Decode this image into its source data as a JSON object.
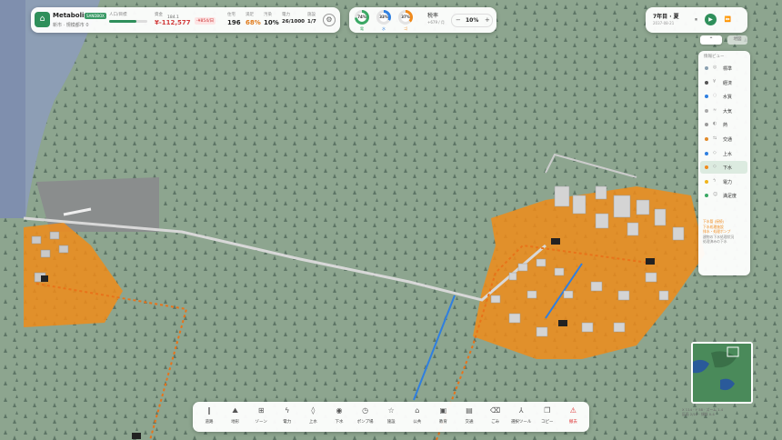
{
  "city": {
    "name": "Metabolis",
    "badge": "SANDBOX",
    "subtitle": "新市 · 規模都市 0",
    "population_label": "人口/目標",
    "population_value": "184.1",
    "population_progress": 0.72,
    "money_label": "資金",
    "money": "¥-112,577",
    "money_delta": "-¥854/日",
    "stats": [
      {
        "label": "住宅",
        "value": "196"
      },
      {
        "label": "満足",
        "value": "68%"
      },
      {
        "label": "汚染",
        "value": "10%"
      },
      {
        "label": "電力",
        "value": "26/1000"
      },
      {
        "label": "施設",
        "value": "1/7"
      }
    ],
    "settings_icon": "gear-icon"
  },
  "gauges": [
    {
      "value": "74%",
      "label": "電",
      "color": "#3aa864"
    },
    {
      "value": "33%",
      "label": "水",
      "color": "#2f7fe0"
    },
    {
      "value": "37%",
      "label": "ゴ",
      "color": "#f08a1c"
    }
  ],
  "tax": {
    "label": "税率",
    "sub": "+679 / 月",
    "value": "10%",
    "minus": "−",
    "plus": "+"
  },
  "time": {
    "season": "7年目 · 夏",
    "sub": "2037-08-21",
    "pause": "⏸",
    "play": "▶",
    "fast": "⏩"
  },
  "layer_toggle": {
    "collapse": "⌃",
    "secondary": "地図"
  },
  "layers": {
    "title": "情報ビュー",
    "items": [
      {
        "name": "標準",
        "color": "#8aa0b0",
        "icon": "◎",
        "active": false
      },
      {
        "name": "経済",
        "color": "#555555",
        "icon": "¥",
        "active": false
      },
      {
        "name": "水質",
        "color": "#2f7fe0",
        "icon": "◌",
        "active": false
      },
      {
        "name": "大気",
        "color": "#aaaaaa",
        "icon": "≈",
        "active": false
      },
      {
        "name": "熱",
        "color": "#999999",
        "icon": "◐",
        "active": false
      },
      {
        "name": "交通",
        "color": "#e08a2a",
        "icon": "⇆",
        "active": false
      },
      {
        "name": "上水",
        "color": "#2f7fe0",
        "icon": "◇",
        "active": false
      },
      {
        "name": "下水",
        "color": "#f08a1c",
        "icon": "◇",
        "active": true
      },
      {
        "name": "電力",
        "color": "#f0b41c",
        "icon": "ϟ",
        "active": false
      },
      {
        "name": "満足度",
        "color": "#3aa864",
        "icon": "☺",
        "active": false
      }
    ],
    "legend": [
      {
        "text": "下水管 (接続)",
        "color": "#f08a1c"
      },
      {
        "text": "下水処理施設",
        "color": "#f08a1c"
      },
      {
        "text": "排水・処理ポンプ",
        "color": "#f08a1c"
      },
      {
        "text": "建物の下水処理状況",
        "color": "#888888"
      },
      {
        "text": "処理済みの下水",
        "color": "#888888"
      }
    ]
  },
  "coords": {
    "line1": "X 114 · Y 58 · ズーム 1.4",
    "line2": "区画 2/18 · 傾斜 0.4"
  },
  "toolbar": [
    {
      "label": "道路",
      "icon": "‖"
    },
    {
      "label": "地形",
      "icon": "⛰"
    },
    {
      "label": "ゾーン",
      "icon": "⊞"
    },
    {
      "label": "電力",
      "icon": "ϟ"
    },
    {
      "label": "上水",
      "icon": "◊"
    },
    {
      "label": "下水",
      "icon": "◉"
    },
    {
      "label": "ポンプ場",
      "icon": "◷"
    },
    {
      "label": "施設",
      "icon": "☆"
    },
    {
      "label": "公共",
      "icon": "⌂"
    },
    {
      "label": "教育",
      "icon": "▣"
    },
    {
      "label": "交通",
      "icon": "▤"
    },
    {
      "label": "ごみ",
      "icon": "⌫"
    },
    {
      "label": "選択ツール",
      "icon": "⅄"
    },
    {
      "label": "コピー",
      "icon": "❐"
    },
    {
      "label": "撤去",
      "icon": "⚠",
      "red": true
    }
  ]
}
